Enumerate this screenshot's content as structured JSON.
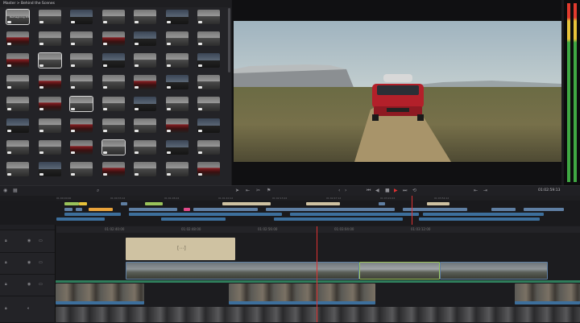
{
  "media_pool": {
    "breadcrumb": "Master > Behind the Scenes",
    "first_tile_label": "Reimagining IDRIS"
  },
  "viewer": {
    "timecode": "01:02:59:13"
  },
  "timeline": {
    "mini_ruler_marks": [
      "01:00:00:00",
      "01:00:33:12",
      "01:01:06:24",
      "01:01:40:12",
      "01:02:13:24",
      "01:02:47:12",
      "01:03:20:24",
      "01:03:54:12"
    ],
    "main_ruler_marks": [
      "01:02:40:00",
      "01:02:48:00",
      "01:02:56:00",
      "01:03:04:00",
      "01:03:12:00"
    ]
  },
  "colors": {
    "playhead": "#e03232",
    "video_clip": "#5f7fa3",
    "audio_clip": "#3d6f9c",
    "title_clip": "#cfc2a2",
    "green_track": "#2f7d5b"
  },
  "icons": [
    "speaker-icon",
    "lock-icon",
    "eye-icon",
    "film-icon",
    "play-icon",
    "stop-icon",
    "rewind-icon",
    "forward-icon",
    "loop-icon",
    "scissors-icon"
  ]
}
